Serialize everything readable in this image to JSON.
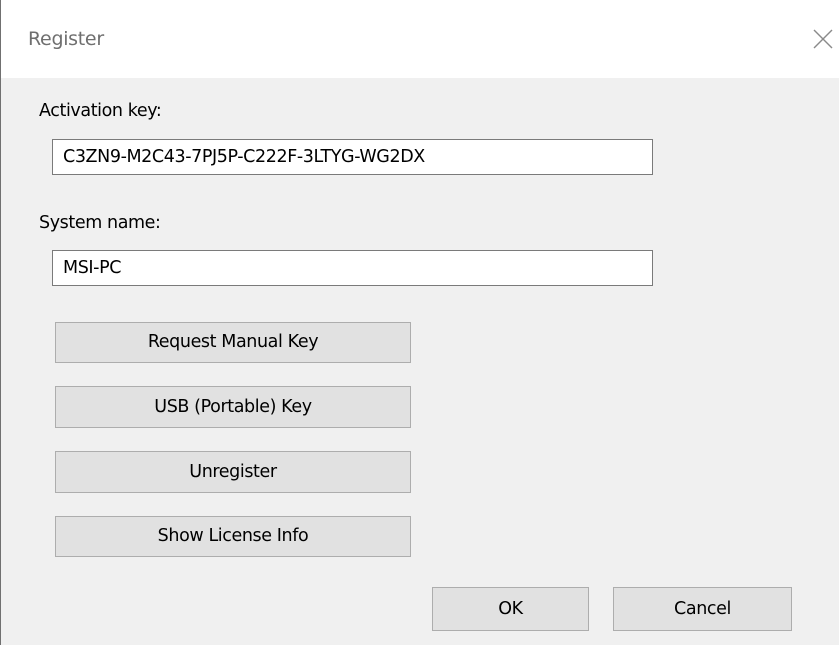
{
  "window": {
    "title": "Register"
  },
  "form": {
    "activation_label": "Activation key:",
    "activation_value": "C3ZN9-M2C43-7PJ5P-C222F-3LTYG-WG2DX",
    "system_label": "System name:",
    "system_value": "MSI-PC"
  },
  "buttons": {
    "request_manual_key": "Request Manual Key",
    "usb_key": "USB (Portable) Key",
    "unregister": "Unregister",
    "show_license_info": "Show License Info",
    "ok": "OK",
    "cancel": "Cancel"
  },
  "icons": {
    "close": "close-icon"
  }
}
